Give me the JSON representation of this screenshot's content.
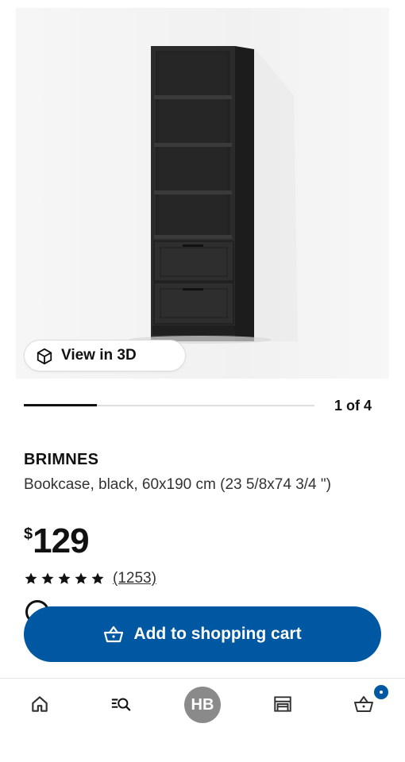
{
  "product": {
    "brand": "BRIMNES",
    "description": "Bookcase, black, 60x190 cm (23 5/8x74 3/4 \")",
    "price_currency": "$",
    "price_amount": "129",
    "rating_stars": 5,
    "review_count": "(1253)"
  },
  "gallery": {
    "view_3d_label": "View in 3D",
    "pager_text": "1 of 4",
    "progress_fraction": 0.25,
    "hero_background": "#f5f5f5",
    "product_color": "#2b2b2b"
  },
  "actions": {
    "add_to_cart_label": "Add to shopping cart",
    "accent_color": "#0058a3"
  },
  "tabbar": {
    "items": [
      {
        "icon": "home-icon"
      },
      {
        "icon": "search-list-icon"
      },
      {
        "icon": "avatar",
        "initials": "HB"
      },
      {
        "icon": "store-icon"
      },
      {
        "icon": "cart-icon",
        "badge": true
      }
    ]
  }
}
